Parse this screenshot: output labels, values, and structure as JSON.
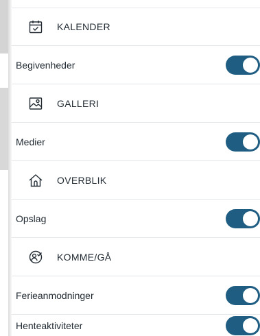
{
  "sections": [
    {
      "header": {
        "label": "KALENDER",
        "icon": "calendar-check-icon"
      },
      "settings": [
        {
          "label": "Begivenheder",
          "enabled": true
        }
      ]
    },
    {
      "header": {
        "label": "GALLERI",
        "icon": "image-gallery-icon"
      },
      "settings": [
        {
          "label": "Medier",
          "enabled": true
        }
      ]
    },
    {
      "header": {
        "label": "OVERBLIK",
        "icon": "home-icon"
      },
      "settings": [
        {
          "label": "Opslag",
          "enabled": true
        }
      ]
    },
    {
      "header": {
        "label": "KOMME/GÅ",
        "icon": "people-check-icon"
      },
      "settings": [
        {
          "label": "Ferieanmodninger",
          "enabled": true
        },
        {
          "label": "Henteaktiviteter",
          "enabled": true
        }
      ]
    }
  ],
  "colors": {
    "toggle_on": "#1f5d82",
    "divider": "#e4e7ea",
    "text": "#222b33"
  }
}
